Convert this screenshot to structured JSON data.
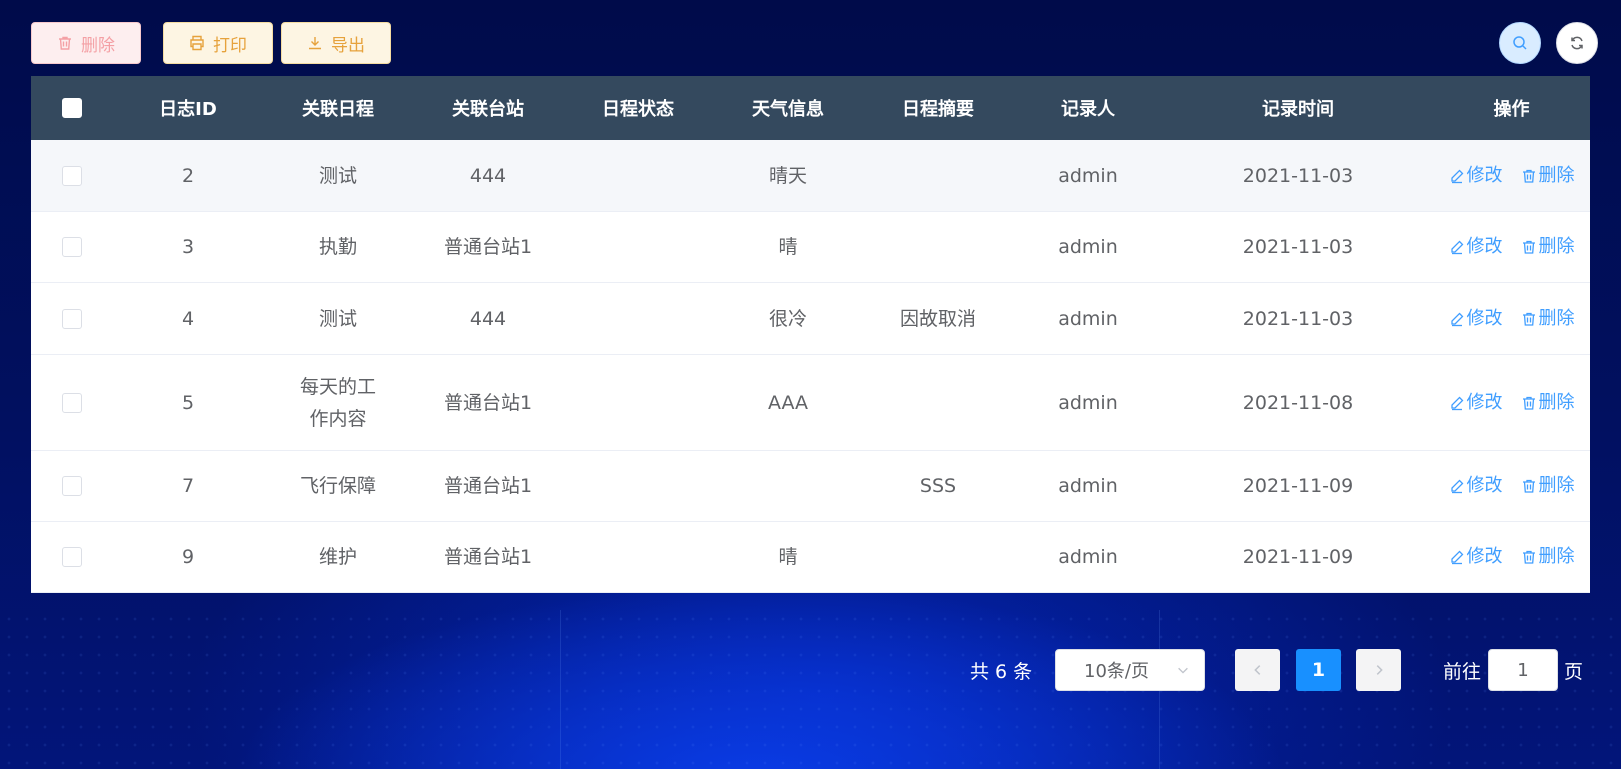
{
  "toolbar": {
    "delete_label": "删除",
    "print_label": "打印",
    "export_label": "导出"
  },
  "table": {
    "headers": [
      "日志ID",
      "关联日程",
      "关联台站",
      "日程状态",
      "天气信息",
      "日程摘要",
      "记录人",
      "记录时间",
      "操作"
    ],
    "rows": [
      {
        "id": "2",
        "schedule": "测试",
        "station": "444",
        "status": "",
        "weather": "晴天",
        "summary": "",
        "recorder": "admin",
        "time": "2021-11-03"
      },
      {
        "id": "3",
        "schedule": "执勤",
        "station": "普通台站1",
        "status": "",
        "weather": "晴",
        "summary": "",
        "recorder": "admin",
        "time": "2021-11-03"
      },
      {
        "id": "4",
        "schedule": "测试",
        "station": "444",
        "status": "",
        "weather": "很冷",
        "summary": "因故取消",
        "recorder": "admin",
        "time": "2021-11-03"
      },
      {
        "id": "5",
        "schedule": "每天的工作内容",
        "station": "普通台站1",
        "status": "",
        "weather": "AAA",
        "summary": "",
        "recorder": "admin",
        "time": "2021-11-08"
      },
      {
        "id": "7",
        "schedule": "飞行保障",
        "station": "普通台站1",
        "status": "",
        "weather": "",
        "summary": "SSS",
        "recorder": "admin",
        "time": "2021-11-09"
      },
      {
        "id": "9",
        "schedule": "维护",
        "station": "普通台站1",
        "status": "",
        "weather": "晴",
        "summary": "",
        "recorder": "admin",
        "time": "2021-11-09"
      }
    ],
    "edit_label": "修改",
    "delete_label": "删除"
  },
  "pagination": {
    "total_text": "共 6 条",
    "page_size": "10条/页",
    "current_page": "1",
    "goto_prefix": "前往",
    "goto_value": "1",
    "goto_suffix": "页"
  },
  "colors": {
    "header_bg": "#34495e",
    "link": "#409eff",
    "current_page": "#1890ff",
    "delete_btn_text": "#f4a0a5",
    "warning_btn_text": "#e6a23c"
  },
  "icons": {
    "toolbar_delete": "trash-icon",
    "toolbar_print": "printer-icon",
    "toolbar_export": "download-icon",
    "search": "search-icon",
    "refresh": "refresh-icon",
    "edit": "edit-icon",
    "row_delete": "trash-icon"
  }
}
